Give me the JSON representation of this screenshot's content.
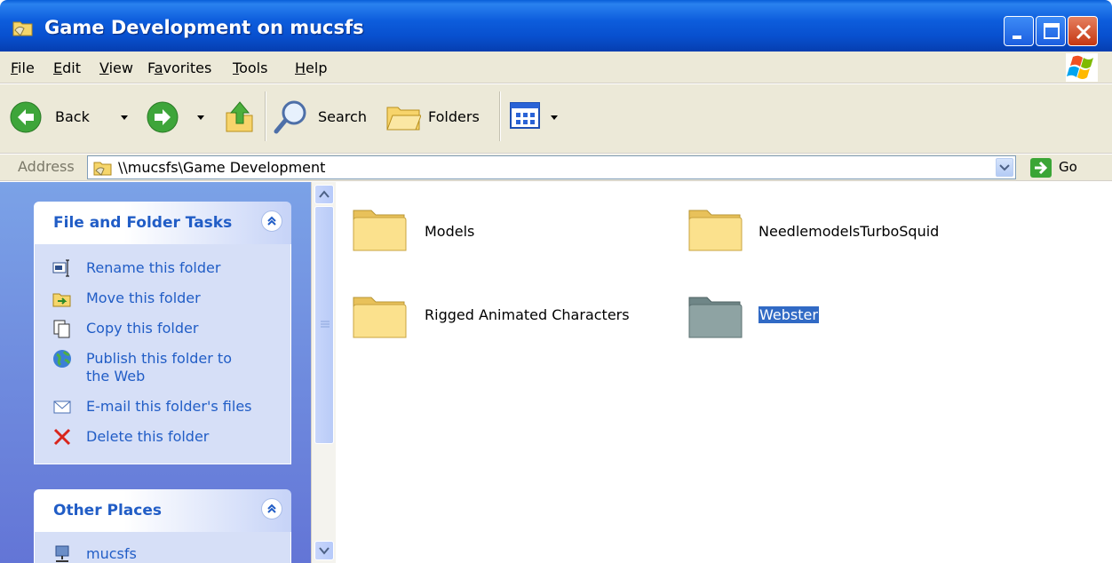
{
  "window": {
    "title": "Game Development on mucsfs"
  },
  "menu": {
    "items": [
      {
        "underline": "F",
        "rest": "ile"
      },
      {
        "underline": "E",
        "rest": "dit"
      },
      {
        "underline": "V",
        "rest": "iew"
      },
      {
        "prefix": "F",
        "underline": "a",
        "rest": "vorites"
      },
      {
        "underline": "T",
        "rest": "ools"
      },
      {
        "underline": "H",
        "rest": "elp"
      }
    ]
  },
  "toolbar": {
    "back_label": "Back",
    "search_label": "Search",
    "folders_label": "Folders"
  },
  "address": {
    "label": "Address",
    "value": "\\\\mucsfs\\Game Development",
    "go_label": "Go"
  },
  "tasks_panel": {
    "title": "File and Folder Tasks",
    "items": [
      {
        "label": "Rename this folder",
        "icon": "rename-icon"
      },
      {
        "label": "Move this folder",
        "icon": "move-icon"
      },
      {
        "label": "Copy this folder",
        "icon": "copy-icon"
      },
      {
        "label": "Publish this folder to the Web",
        "icon": "globe-icon"
      },
      {
        "label": "E-mail this folder's files",
        "icon": "email-icon"
      },
      {
        "label": "Delete this folder",
        "icon": "delete-icon"
      }
    ]
  },
  "places_panel": {
    "title": "Other Places",
    "items": [
      {
        "label": "mucsfs",
        "icon": "network-computer-icon"
      }
    ]
  },
  "folders": [
    {
      "name": "Models",
      "selected": false
    },
    {
      "name": "NeedlemodelsTurboSquid",
      "selected": false
    },
    {
      "name": "Rigged Animated Characters",
      "selected": false
    },
    {
      "name": "Webster",
      "selected": true
    }
  ],
  "colors": {
    "title_bar": "#0a5fd8",
    "task_link": "#215dc6",
    "selection": "#316ac5",
    "folder": "#f8d775"
  }
}
